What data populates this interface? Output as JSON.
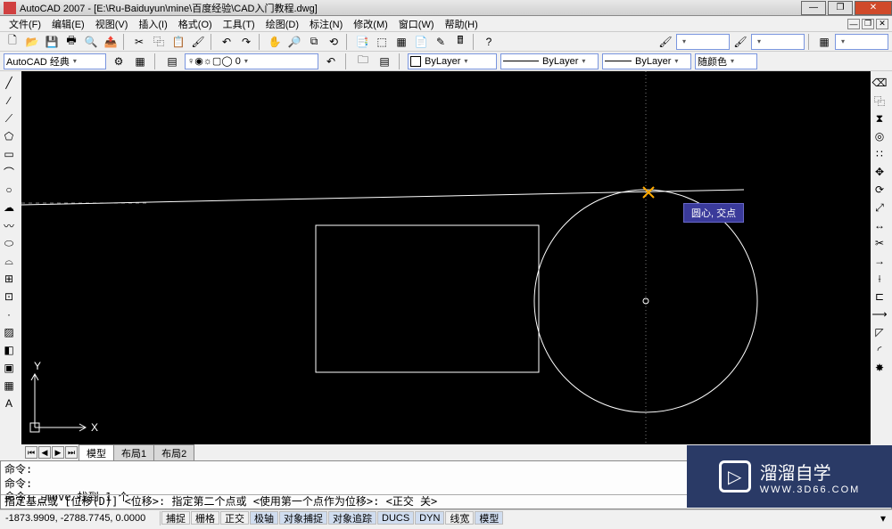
{
  "title": "AutoCAD 2007 - [E:\\Ru-Baiduyun\\mine\\百度经验\\CAD入门教程.dwg]",
  "menu": {
    "file": "文件(F)",
    "edit": "编辑(E)",
    "view": "视图(V)",
    "insert": "插入(I)",
    "format": "格式(O)",
    "tools": "工具(T)",
    "draw": "绘图(D)",
    "dimension": "标注(N)",
    "modify": "修改(M)",
    "window": "窗口(W)",
    "help": "帮助(H)"
  },
  "workspace": "AutoCAD 经典",
  "layer_state": "♀◉☼▢◯ 0",
  "layer_combo1": "ByLayer",
  "layer_combo2": "ByLayer",
  "layer_combo3": "ByLayer",
  "layer_combo4": "随颜色",
  "tabs": {
    "model": "模型",
    "layout1": "布局1",
    "layout2": "布局2"
  },
  "command": {
    "l1": "命令:",
    "l2": "命令:",
    "l3": "命令: _move 找到 1 个",
    "l4": "指定基点或 [位移(D)] <位移>:   指定第二个点或 <使用第一个点作为位移>:   <正交 关>"
  },
  "coords": "-1873.9909, -2788.7745, 0.0000",
  "status": {
    "snap": "捕捉",
    "grid": "栅格",
    "ortho": "正交",
    "polar": "极轴",
    "osnap": "对象捕捉",
    "otrack": "对象追踪",
    "ducs": "DUCS",
    "dyn": "DYN",
    "lwt": "线宽",
    "model": "模型"
  },
  "tooltip": "圆心, 交点",
  "axis": {
    "y": "Y",
    "x": "X"
  },
  "watermark": {
    "main": "溜溜自学",
    "sub": "WWW.3D66.COM"
  }
}
